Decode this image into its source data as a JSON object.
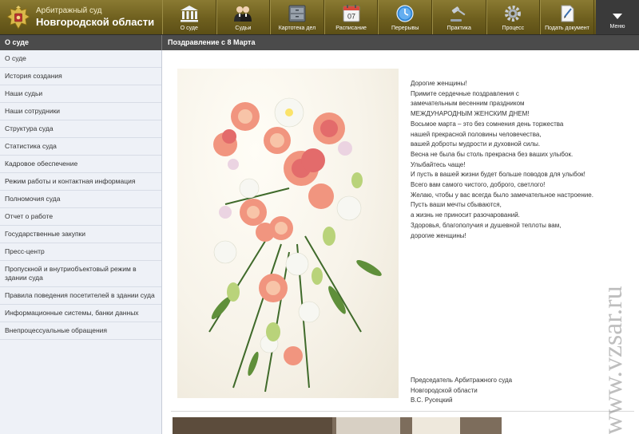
{
  "header": {
    "court_subtitle": "Арбитражный суд",
    "court_name": "Новгородской области",
    "nav": [
      {
        "label": "О суде",
        "icon": "building-icon"
      },
      {
        "label": "Судьи",
        "icon": "judges-icon"
      },
      {
        "label": "Картотека дел",
        "icon": "cabinet-icon"
      },
      {
        "label": "Расписание",
        "icon": "calendar-icon",
        "badge": "07"
      },
      {
        "label": "Перерывы",
        "icon": "clock-icon"
      },
      {
        "label": "Практика",
        "icon": "gavel-icon"
      },
      {
        "label": "Процесс",
        "icon": "gear-icon"
      },
      {
        "label": "Подать документ",
        "icon": "document-icon"
      }
    ],
    "menu_label": "Меню"
  },
  "subbar": {
    "section": "О суде",
    "page_title": "Поздравление с 8 Марта"
  },
  "sidebar": {
    "items": [
      "О суде",
      "История создания",
      "Наши судьи",
      "Наши сотрудники",
      "Структура суда",
      "Статистика суда",
      "Кадровое обеспечение",
      "Режим работы и контактная информация",
      "Полномочия суда",
      "Отчет о работе",
      "Государственные закупки",
      "Пресс-центр",
      "Пропускной и внутриобъектовый режим в здании суда",
      "Правила поведения посетителей в здании суда",
      "Информационные системы, банки данных",
      "Внепроцессуальные обращения"
    ]
  },
  "content": {
    "greeting": [
      "Дорогие женщины!",
      "Примите сердечные поздравления с",
      "замечательным весенним праздником",
      "МЕЖДУНАРОДНЫМ ЖЕНСКИМ ДНЕМ!",
      "Восьмое марта – это без сомнения день торжества",
      "нашей прекрасной половины человечества,",
      "вашей доброты мудрости и духовной силы.",
      "Весна не была бы столь прекрасна без ваших улыбок.",
      "Улыбайтесь чаще!",
      "И пусть в вашей жизни будет больше поводов для улыбок!",
      "Всего вам самого чистого, доброго, светлого!",
      "Желаю, чтобы у вас всегда было замечательное настроение.",
      "Пусть ваши мечты сбываются,",
      "а жизнь не приносит разочарований.",
      "Здоровья, благополучия и душевной теплоты вам,",
      "дорогие женщины!"
    ],
    "signature": [
      "Председатель Арбитражного суда",
      "Новгородской области",
      "В.С. Русецкий"
    ]
  },
  "watermark": "www.vzsar.ru",
  "colors": {
    "header_gold": "#6e5f1e",
    "subbar": "#4b4b4b",
    "sidebar_bg": "#eef1f7",
    "menu_btn": "#3a3a3a"
  }
}
